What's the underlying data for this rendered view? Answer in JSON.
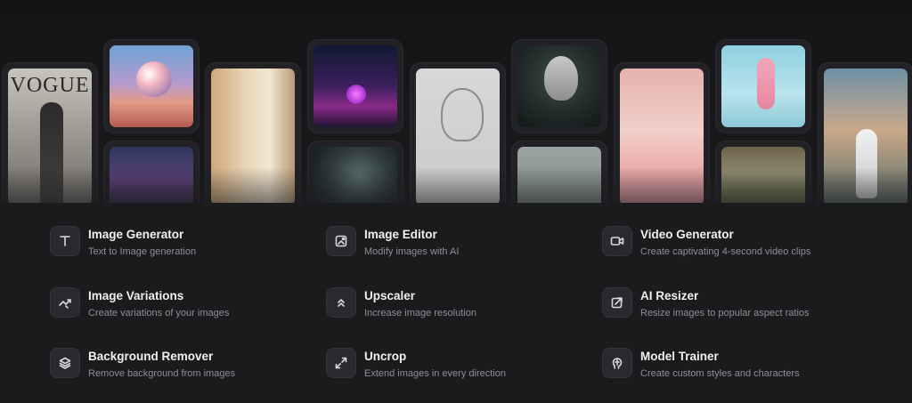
{
  "gallery": {
    "vogue_logo": "VOGUE"
  },
  "features": [
    {
      "title": "Image Generator",
      "description": "Text to Image generation",
      "icon": "text-t-icon"
    },
    {
      "title": "Image Editor",
      "description": "Modify images with AI",
      "icon": "image-edit-icon"
    },
    {
      "title": "Video Generator",
      "description": "Create captivating 4-second video clips",
      "icon": "video-camera-icon"
    },
    {
      "title": "Image Variations",
      "description": "Create variations of your images",
      "icon": "shuffle-icon"
    },
    {
      "title": "Upscaler",
      "description": "Increase image resolution",
      "icon": "chevrons-up-icon"
    },
    {
      "title": "AI Resizer",
      "description": "Resize images to popular aspect ratios",
      "icon": "resize-icon"
    },
    {
      "title": "Background Remover",
      "description": "Remove background from images",
      "icon": "layers-icon"
    },
    {
      "title": "Uncrop",
      "description": "Extend images in every direction",
      "icon": "expand-icon"
    },
    {
      "title": "Model Trainer",
      "description": "Create custom styles and characters",
      "icon": "brain-icon"
    }
  ]
}
